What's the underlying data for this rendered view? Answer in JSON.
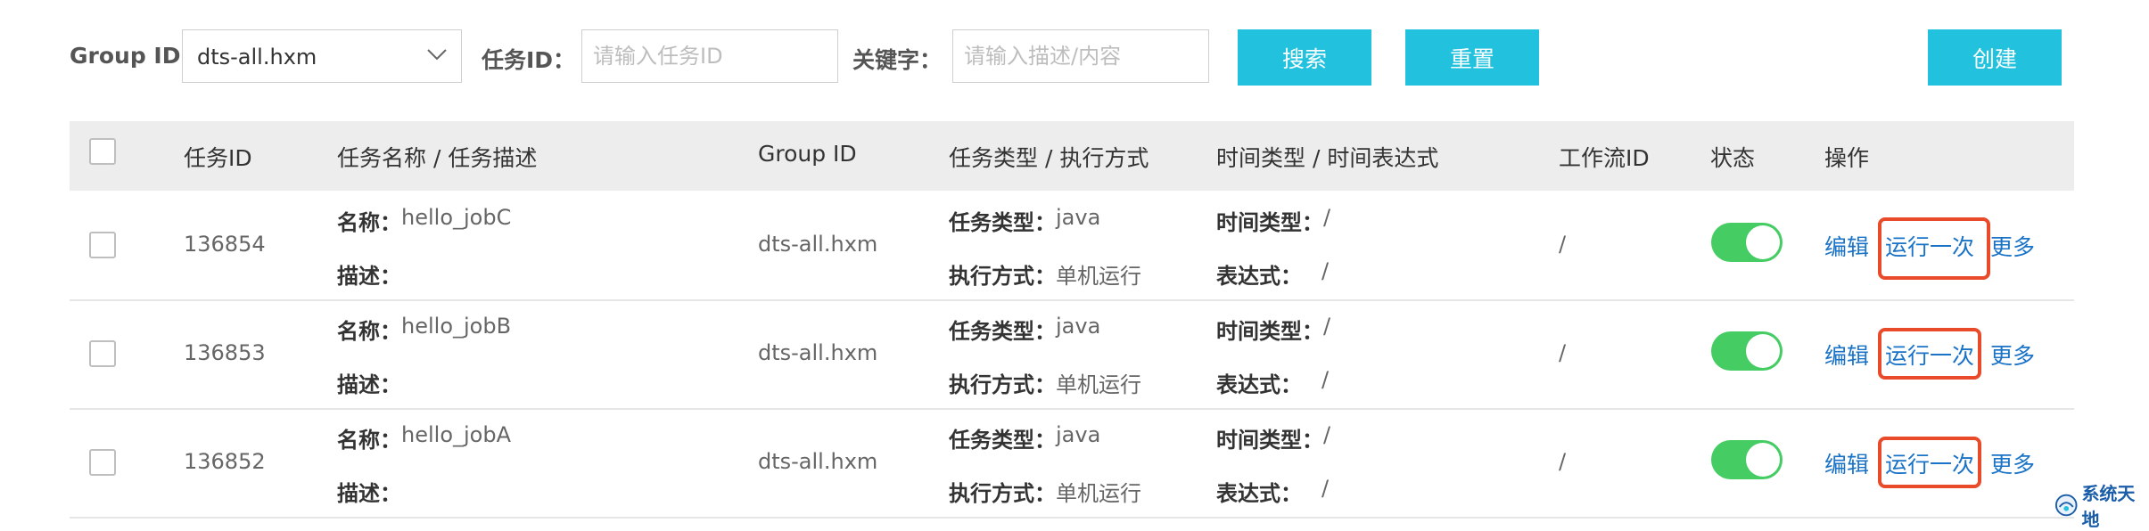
{
  "filters": {
    "group_id_label": "Group ID:",
    "group_id_value": "dts-all.hxm",
    "task_id_label": "任务ID：",
    "task_id_placeholder": "请输入任务ID",
    "keyword_label": "关键字：",
    "keyword_placeholder": "请输入描述/内容",
    "search_label": "搜索",
    "reset_label": "重置",
    "create_label": "创建"
  },
  "table": {
    "headers": {
      "task_id": "任务ID",
      "name_desc": "任务名称 / 任务描述",
      "group_id": "Group ID",
      "type_mode": "任务类型 / 执行方式",
      "time_expr": "时间类型 / 时间表达式",
      "workflow_id": "工作流ID",
      "status": "状态",
      "actions": "操作"
    },
    "field_labels": {
      "name": "名称：",
      "desc": "描述：",
      "task_type": "任务类型：",
      "exec_mode": "执行方式：",
      "time_type": "时间类型：",
      "expr": "表达式："
    },
    "action_labels": {
      "edit": "编辑",
      "run_once": "运行一次",
      "more": "更多"
    },
    "rows": [
      {
        "id": "136854",
        "name": "hello_jobC",
        "desc": "",
        "group": "dts-all.hxm",
        "task_type": "java",
        "exec_mode": "单机运行",
        "time_type": "/",
        "expr": "/",
        "workflow": "/",
        "status_on": true
      },
      {
        "id": "136853",
        "name": "hello_jobB",
        "desc": "",
        "group": "dts-all.hxm",
        "task_type": "java",
        "exec_mode": "单机运行",
        "time_type": "/",
        "expr": "/",
        "workflow": "/",
        "status_on": true
      },
      {
        "id": "136852",
        "name": "hello_jobA",
        "desc": "",
        "group": "dts-all.hxm",
        "task_type": "java",
        "exec_mode": "单机运行",
        "time_type": "/",
        "expr": "/",
        "workflow": "/",
        "status_on": true
      }
    ]
  },
  "watermark": {
    "text": "系统天地"
  },
  "colors": {
    "accent": "#22c2de",
    "link": "#1a73c7",
    "toggle_on": "#45cc63",
    "highlight": "#e84a2a"
  }
}
